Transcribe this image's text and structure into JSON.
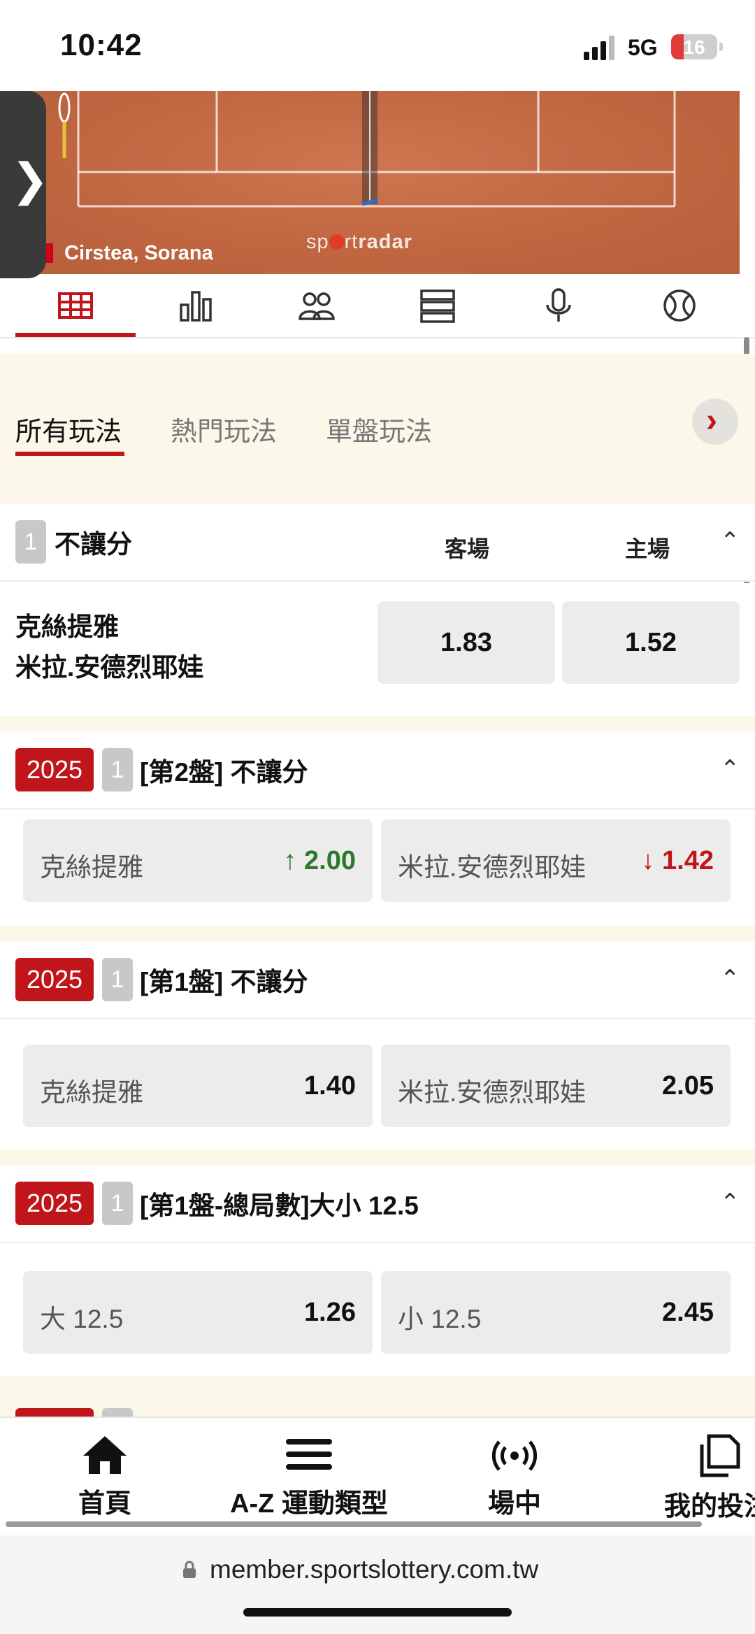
{
  "status": {
    "time": "10:42",
    "network": "5G",
    "battery": "16"
  },
  "court": {
    "player": "Cirstea, Sorana",
    "brand_a": "sp",
    "brand_b": "rt",
    "brand_c": "radar"
  },
  "side_tab": {
    "icon": "chevron-right-icon",
    "glyph": "❯"
  },
  "icon_tabs": [
    "scoreboard-icon",
    "stats-bar-icon",
    "players-icon",
    "list-icon",
    "microphone-icon",
    "tennis-ball-icon"
  ],
  "filter_tabs": {
    "all": "所有玩法",
    "hot": "熱門玩法",
    "set": "單盤玩法",
    "next_glyph": "›"
  },
  "market1": {
    "count": "1",
    "title": "不讓分",
    "away_hdr": "客場",
    "home_hdr": "主場",
    "team_a": "克絲提雅",
    "team_b": "米拉.安德烈耶娃",
    "odd_away": "1.83",
    "odd_home": "1.52"
  },
  "market2": {
    "year": "2025",
    "count": "1",
    "title": "[第2盤] 不讓分",
    "sel_a": "克絲提雅",
    "val_a": "2.00",
    "trend_a": "up",
    "sel_b": "米拉.安德烈耶娃",
    "val_b": "1.42",
    "trend_b": "down"
  },
  "market3": {
    "year": "2025",
    "count": "1",
    "title": "[第1盤] 不讓分",
    "sel_a": "克絲提雅",
    "val_a": "1.40",
    "sel_b": "米拉.安德烈耶娃",
    "val_b": "2.05"
  },
  "market4": {
    "year": "2025",
    "count": "1",
    "title": "[第1盤-總局數]大小 12.5",
    "sel_a": "大 12.5",
    "val_a": "1.26",
    "sel_b": "小 12.5",
    "val_b": "2.45"
  },
  "arrows": {
    "up": "↑",
    "down": "↓",
    "caret": "⌃"
  },
  "bottom_nav": {
    "home": "首頁",
    "sports": "A-Z 運動類型",
    "live": "場中",
    "bets": "我的投注"
  },
  "url": "member.sportslottery.com.tw",
  "colors": {
    "accent": "#c0151a",
    "up": "#2a7a2a",
    "court": "#c66a45"
  }
}
